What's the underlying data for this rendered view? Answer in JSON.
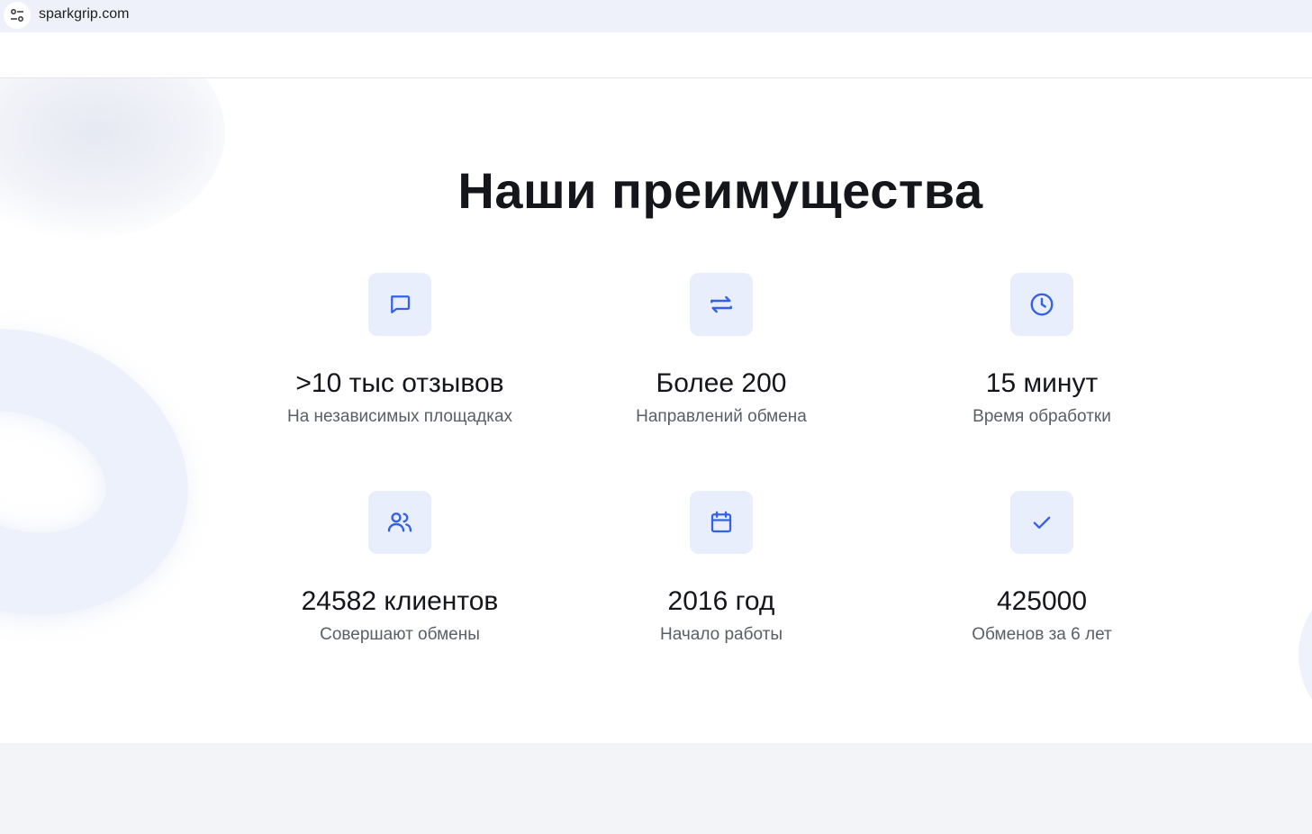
{
  "browser": {
    "url": "sparkgrip.com",
    "toolbar_glyph": ":"
  },
  "section": {
    "title": "Наши преимущества"
  },
  "features": [
    {
      "icon": "chat-bubble-icon",
      "value": ">10 тыс отзывов",
      "caption": "На независимых площадках"
    },
    {
      "icon": "exchange-arrows-icon",
      "value": "Более 200",
      "caption": "Направлений обмена"
    },
    {
      "icon": "clock-icon",
      "value": "15 минут",
      "caption": "Время обработки"
    },
    {
      "icon": "users-icon",
      "value": "24582 клиентов",
      "caption": "Совершают обмены"
    },
    {
      "icon": "calendar-icon",
      "value": "2016 год",
      "caption": "Начало работы"
    },
    {
      "icon": "checkmark-icon",
      "value": "425000",
      "caption": "Обменов за 6 лет"
    }
  ],
  "colors": {
    "accent": "#3361e8",
    "icon_bg": "#e9eefc",
    "text": "#14161c",
    "caption": "#5a5e66"
  }
}
